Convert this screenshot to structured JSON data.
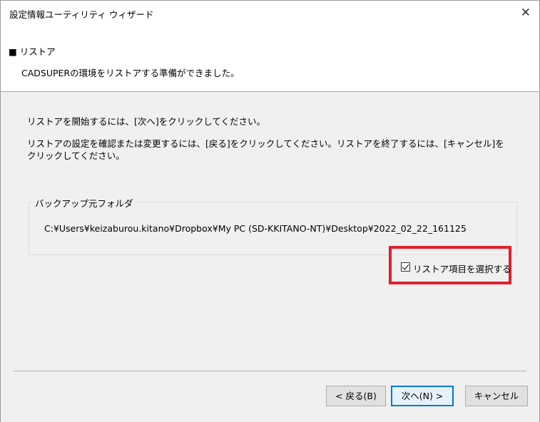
{
  "window": {
    "title": "設定情報ユーティリティ ウィザード",
    "close_glyph": "✕"
  },
  "header": {
    "title": "■ リストア",
    "subtitle": "CADSUPERの環境をリストアする準備ができました。"
  },
  "content": {
    "para1": "リストアを開始するには、[次へ]をクリックしてください。",
    "para2": "リストアの設定を確認または変更するには、[戻る]をクリックしてください。リストアを終了するには、[キャンセル]をクリックしてください。",
    "group_label": "バックアップ元フォルダ",
    "path": "C:¥Users¥keizaburou.kitano¥Dropbox¥My PC (SD-KKITANO-NT)¥Desktop¥2022_02_22_161125",
    "checkbox_label": "リストア項目を選択する",
    "checkbox_checked": true
  },
  "buttons": {
    "back": "< 戻る(B)",
    "next": "次へ(N) >",
    "cancel": "キャンセル"
  },
  "colors": {
    "highlight": "#e0202b",
    "primary_border": "#0078d7"
  }
}
